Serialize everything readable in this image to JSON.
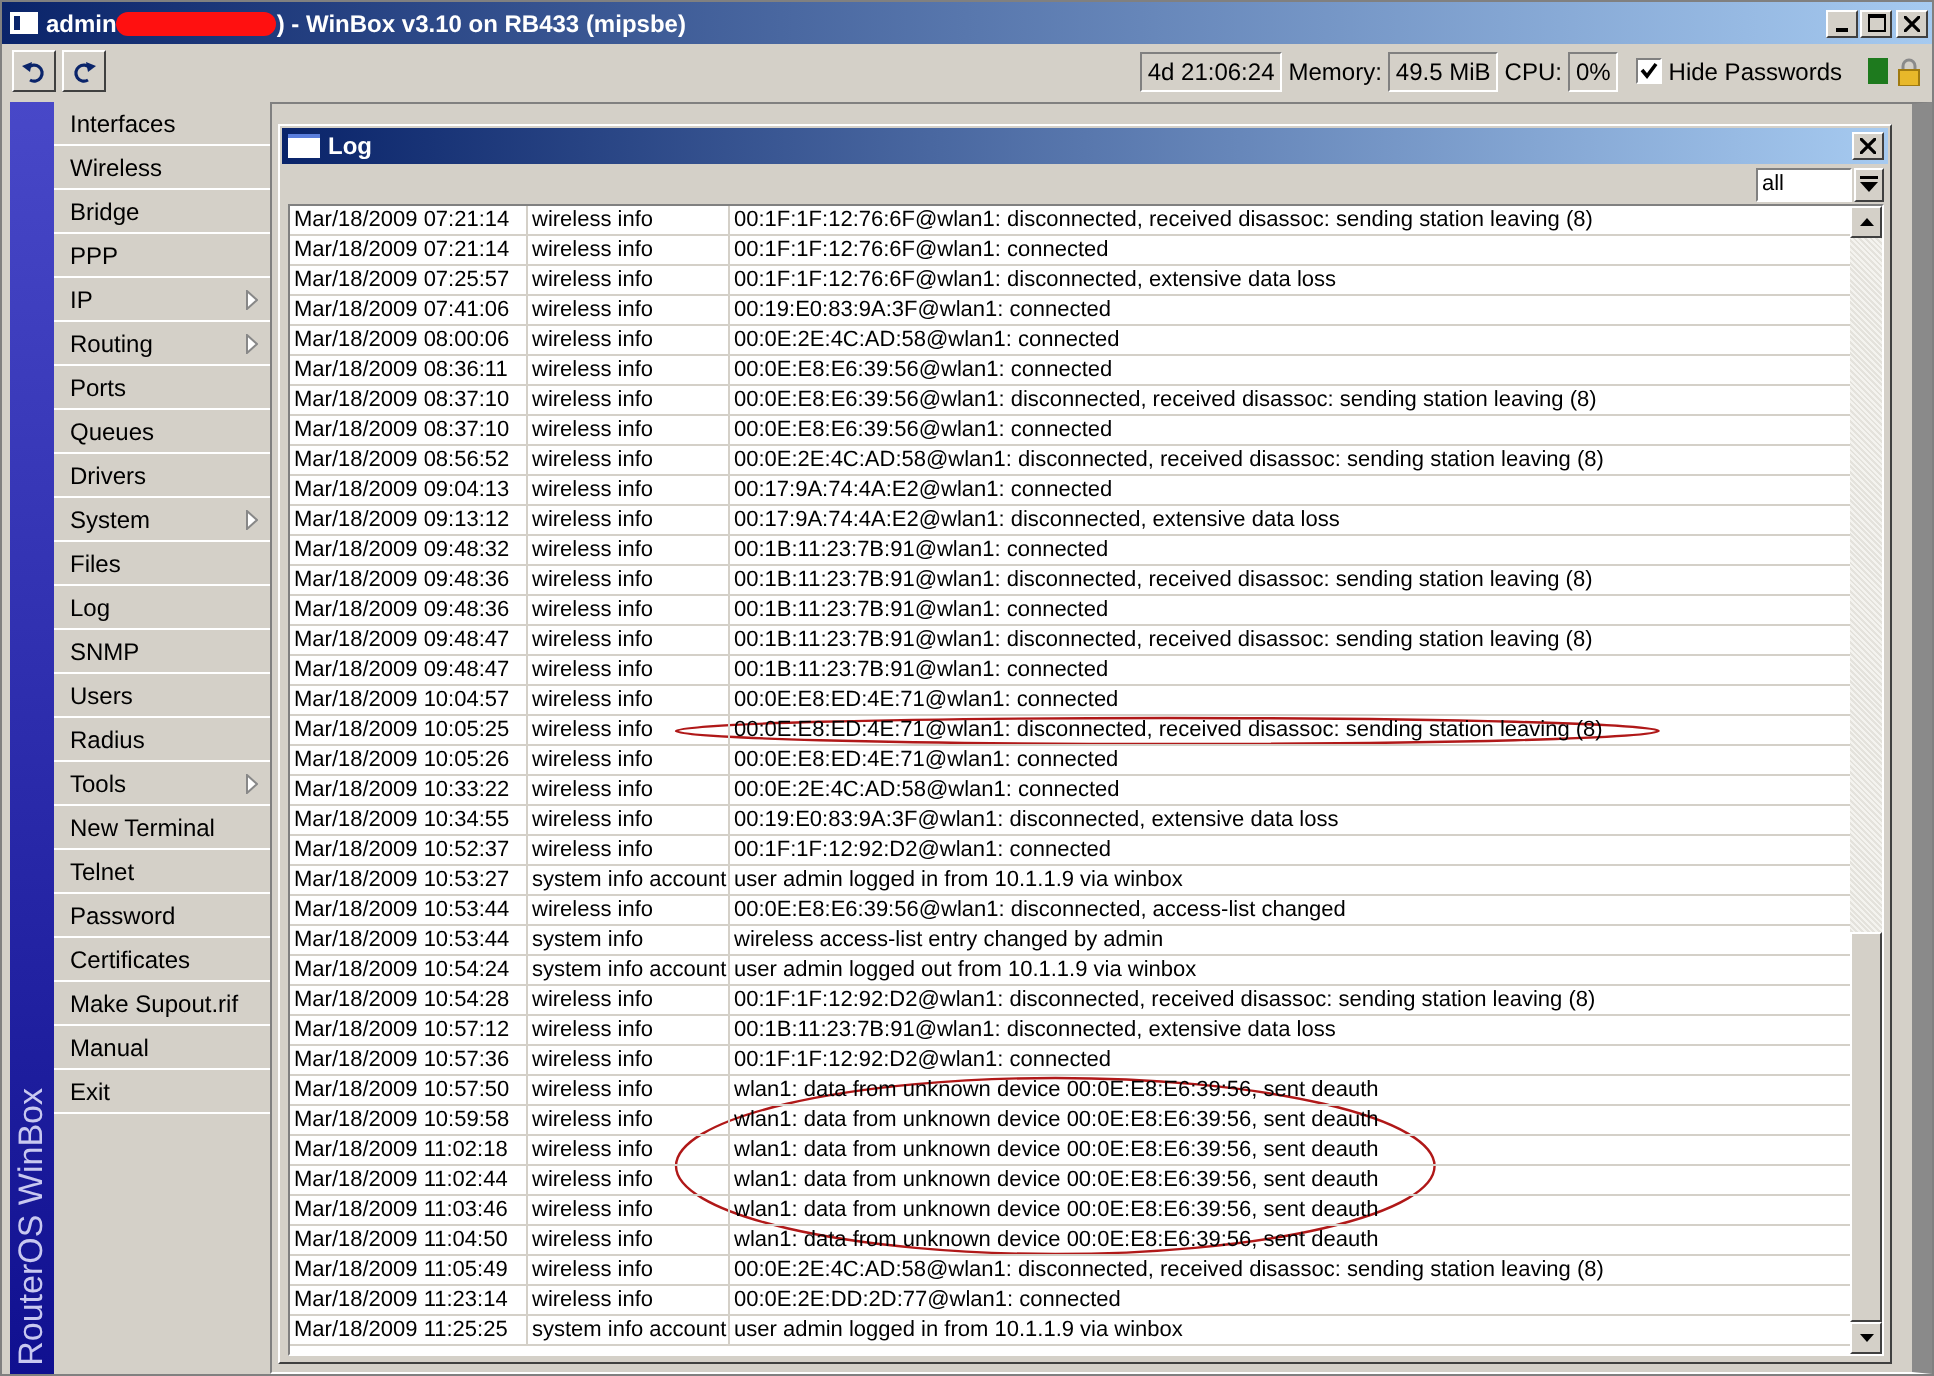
{
  "window": {
    "title_prefix": "admin",
    "redacted": true,
    "title_suffix": ") - WinBox v3.10 on RB433 (mipsbe)"
  },
  "toolbar": {
    "uptime": "4d 21:06:24",
    "memory_label": "Memory:",
    "memory": "49.5 MiB",
    "cpu_label": "CPU:",
    "cpu": "0%",
    "hide_passwords": {
      "label": "Hide Passwords",
      "checked": true
    }
  },
  "sidebar": {
    "brand": "RouterOS WinBox",
    "items": [
      {
        "label": "Interfaces",
        "submenu": false
      },
      {
        "label": "Wireless",
        "submenu": false
      },
      {
        "label": "Bridge",
        "submenu": false
      },
      {
        "label": "PPP",
        "submenu": false
      },
      {
        "label": "IP",
        "submenu": true
      },
      {
        "label": "Routing",
        "submenu": true
      },
      {
        "label": "Ports",
        "submenu": false
      },
      {
        "label": "Queues",
        "submenu": false
      },
      {
        "label": "Drivers",
        "submenu": false
      },
      {
        "label": "System",
        "submenu": true
      },
      {
        "label": "Files",
        "submenu": false
      },
      {
        "label": "Log",
        "submenu": false
      },
      {
        "label": "SNMP",
        "submenu": false
      },
      {
        "label": "Users",
        "submenu": false
      },
      {
        "label": "Radius",
        "submenu": false
      },
      {
        "label": "Tools",
        "submenu": true
      },
      {
        "label": "New Terminal",
        "submenu": false
      },
      {
        "label": "Telnet",
        "submenu": false
      },
      {
        "label": "Password",
        "submenu": false
      },
      {
        "label": "Certificates",
        "submenu": false
      },
      {
        "label": "Make Supout.rif",
        "submenu": false
      },
      {
        "label": "Manual",
        "submenu": false
      },
      {
        "label": "Exit",
        "submenu": false
      }
    ]
  },
  "log": {
    "title": "Log",
    "filter": "all",
    "rows": [
      {
        "time": "Mar/18/2009 07:21:14",
        "topics": "wireless info",
        "message": "00:1F:1F:12:76:6F@wlan1: disconnected, received disassoc: sending station leaving (8)",
        "circled": false
      },
      {
        "time": "Mar/18/2009 07:21:14",
        "topics": "wireless info",
        "message": "00:1F:1F:12:76:6F@wlan1: connected",
        "circled": false
      },
      {
        "time": "Mar/18/2009 07:25:57",
        "topics": "wireless info",
        "message": "00:1F:1F:12:76:6F@wlan1: disconnected, extensive data loss",
        "circled": false
      },
      {
        "time": "Mar/18/2009 07:41:06",
        "topics": "wireless info",
        "message": "00:19:E0:83:9A:3F@wlan1: connected",
        "circled": false
      },
      {
        "time": "Mar/18/2009 08:00:06",
        "topics": "wireless info",
        "message": "00:0E:2E:4C:AD:58@wlan1: connected",
        "circled": false
      },
      {
        "time": "Mar/18/2009 08:36:11",
        "topics": "wireless info",
        "message": "00:0E:E8:E6:39:56@wlan1: connected",
        "circled": false
      },
      {
        "time": "Mar/18/2009 08:37:10",
        "topics": "wireless info",
        "message": "00:0E:E8:E6:39:56@wlan1: disconnected, received disassoc: sending station leaving (8)",
        "circled": false
      },
      {
        "time": "Mar/18/2009 08:37:10",
        "topics": "wireless info",
        "message": "00:0E:E8:E6:39:56@wlan1: connected",
        "circled": false
      },
      {
        "time": "Mar/18/2009 08:56:52",
        "topics": "wireless info",
        "message": "00:0E:2E:4C:AD:58@wlan1: disconnected, received disassoc: sending station leaving (8)",
        "circled": false
      },
      {
        "time": "Mar/18/2009 09:04:13",
        "topics": "wireless info",
        "message": "00:17:9A:74:4A:E2@wlan1: connected",
        "circled": false
      },
      {
        "time": "Mar/18/2009 09:13:12",
        "topics": "wireless info",
        "message": "00:17:9A:74:4A:E2@wlan1: disconnected, extensive data loss",
        "circled": false
      },
      {
        "time": "Mar/18/2009 09:48:32",
        "topics": "wireless info",
        "message": "00:1B:11:23:7B:91@wlan1: connected",
        "circled": false
      },
      {
        "time": "Mar/18/2009 09:48:36",
        "topics": "wireless info",
        "message": "00:1B:11:23:7B:91@wlan1: disconnected, received disassoc: sending station leaving (8)",
        "circled": false
      },
      {
        "time": "Mar/18/2009 09:48:36",
        "topics": "wireless info",
        "message": "00:1B:11:23:7B:91@wlan1: connected",
        "circled": false
      },
      {
        "time": "Mar/18/2009 09:48:47",
        "topics": "wireless info",
        "message": "00:1B:11:23:7B:91@wlan1: disconnected, received disassoc: sending station leaving (8)",
        "circled": false
      },
      {
        "time": "Mar/18/2009 09:48:47",
        "topics": "wireless info",
        "message": "00:1B:11:23:7B:91@wlan1: connected",
        "circled": false
      },
      {
        "time": "Mar/18/2009 10:04:57",
        "topics": "wireless info",
        "message": "00:0E:E8:ED:4E:71@wlan1: connected",
        "circled": false
      },
      {
        "time": "Mar/18/2009 10:05:25",
        "topics": "wireless info",
        "message": "00:0E:E8:ED:4E:71@wlan1: disconnected, received disassoc: sending station leaving (8)",
        "circled": true
      },
      {
        "time": "Mar/18/2009 10:05:26",
        "topics": "wireless info",
        "message": "00:0E:E8:ED:4E:71@wlan1: connected",
        "circled": false
      },
      {
        "time": "Mar/18/2009 10:33:22",
        "topics": "wireless info",
        "message": "00:0E:2E:4C:AD:58@wlan1: connected",
        "circled": false
      },
      {
        "time": "Mar/18/2009 10:34:55",
        "topics": "wireless info",
        "message": "00:19:E0:83:9A:3F@wlan1: disconnected, extensive data loss",
        "circled": false
      },
      {
        "time": "Mar/18/2009 10:52:37",
        "topics": "wireless info",
        "message": "00:1F:1F:12:92:D2@wlan1: connected",
        "circled": false
      },
      {
        "time": "Mar/18/2009 10:53:27",
        "topics": "system info account",
        "message": "user admin logged in from 10.1.1.9 via winbox",
        "circled": false
      },
      {
        "time": "Mar/18/2009 10:53:44",
        "topics": "wireless info",
        "message": "00:0E:E8:E6:39:56@wlan1: disconnected, access-list changed",
        "circled": false
      },
      {
        "time": "Mar/18/2009 10:53:44",
        "topics": "system info",
        "message": "wireless access-list entry changed by admin",
        "circled": false
      },
      {
        "time": "Mar/18/2009 10:54:24",
        "topics": "system info account",
        "message": "user admin logged out from 10.1.1.9 via winbox",
        "circled": false
      },
      {
        "time": "Mar/18/2009 10:54:28",
        "topics": "wireless info",
        "message": "00:1F:1F:12:92:D2@wlan1: disconnected, received disassoc: sending station leaving (8)",
        "circled": false
      },
      {
        "time": "Mar/18/2009 10:57:12",
        "topics": "wireless info",
        "message": "00:1B:11:23:7B:91@wlan1: disconnected, extensive data loss",
        "circled": false
      },
      {
        "time": "Mar/18/2009 10:57:36",
        "topics": "wireless info",
        "message": "00:1F:1F:12:92:D2@wlan1: connected",
        "circled": false
      },
      {
        "time": "Mar/18/2009 10:57:50",
        "topics": "wireless info",
        "message": "wlan1: data from unknown device 00:0E:E8:E6:39:56, sent deauth",
        "circled": true
      },
      {
        "time": "Mar/18/2009 10:59:58",
        "topics": "wireless info",
        "message": "wlan1: data from unknown device 00:0E:E8:E6:39:56, sent deauth",
        "circled": true
      },
      {
        "time": "Mar/18/2009 11:02:18",
        "topics": "wireless info",
        "message": "wlan1: data from unknown device 00:0E:E8:E6:39:56, sent deauth",
        "circled": true
      },
      {
        "time": "Mar/18/2009 11:02:44",
        "topics": "wireless info",
        "message": "wlan1: data from unknown device 00:0E:E8:E6:39:56, sent deauth",
        "circled": true
      },
      {
        "time": "Mar/18/2009 11:03:46",
        "topics": "wireless info",
        "message": "wlan1: data from unknown device 00:0E:E8:E6:39:56, sent deauth",
        "circled": true
      },
      {
        "time": "Mar/18/2009 11:04:50",
        "topics": "wireless info",
        "message": "wlan1: data from unknown device 00:0E:E8:E6:39:56, sent deauth",
        "circled": true
      },
      {
        "time": "Mar/18/2009 11:05:49",
        "topics": "wireless info",
        "message": "00:0E:2E:4C:AD:58@wlan1: disconnected, received disassoc: sending station leaving (8)",
        "circled": false
      },
      {
        "time": "Mar/18/2009 11:23:14",
        "topics": "wireless info",
        "message": "00:0E:2E:DD:2D:77@wlan1: connected",
        "circled": false
      },
      {
        "time": "Mar/18/2009 11:25:25",
        "topics": "system info account",
        "message": "user admin logged in from 10.1.1.9 via winbox",
        "circled": false
      }
    ]
  }
}
